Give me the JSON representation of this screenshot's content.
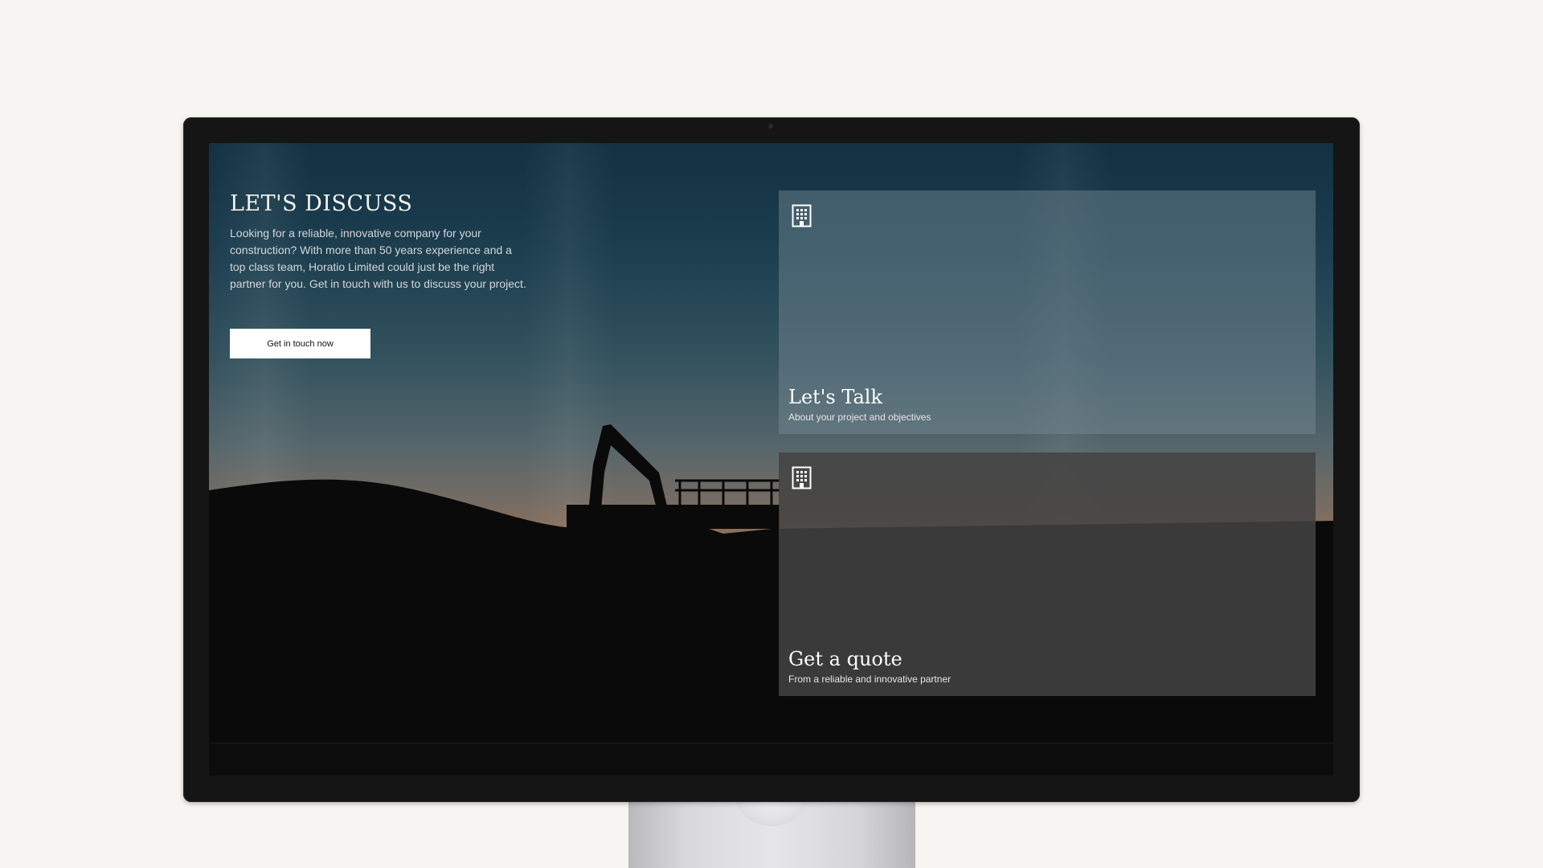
{
  "hero": {
    "title": "LET'S DISCUSS",
    "description": "Looking for a reliable, innovative company for your construction? With more than 50 years experience and a top class team, Horatio Limited could just be the right partner for you. Get in touch with us to discuss your project.",
    "cta_label": "Get in touch now"
  },
  "cards": [
    {
      "icon": "building-icon",
      "title": "Let's Talk",
      "subtitle": "About your project and objectives"
    },
    {
      "icon": "building-icon",
      "title": "Get a quote",
      "subtitle": "From a reliable and innovative partner"
    }
  ],
  "colors": {
    "background": "#f6f5f1",
    "monitor_frame": "#151515",
    "button_bg": "#ffffff"
  }
}
